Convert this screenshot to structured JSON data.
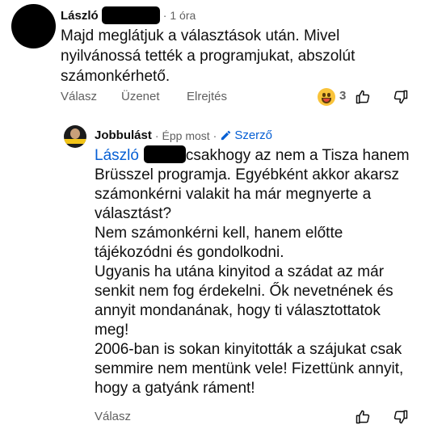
{
  "comment1": {
    "author": "László",
    "time": "1 óra",
    "text_lines": [
      "Majd meglátjuk a választások után. Mivel",
      "nyilvánossá tették a programjukat, abszolút",
      "számonkérhető."
    ],
    "actions": {
      "reply": "Válasz",
      "message": "Üzenet",
      "hide": "Elrejtés",
      "reaction_count": "3"
    }
  },
  "reply1": {
    "author": "Jobbulást",
    "time": "Épp most",
    "author_badge": "Szerző",
    "mention": "László",
    "first_line_rest": "csakhogy az nem a Tisza hanem",
    "text_lines": [
      "Brüsszel programja. Egyébként akkor akarsz",
      "számonkérni valakit ha már megnyerte a",
      "választást?",
      "Nem számonkérni kell, hanem előtte",
      "tájékozódni és gondolkodni.",
      "Ugyanis ha utána kinyitod a szádat az már",
      "senkit nem fog érdekelni. Ők nevetnének és",
      "annyit mondanának, hogy ti választottatok",
      "meg!",
      "2006-ban is sokan kinyitották a szájukat csak",
      "semmire nem mentünk vele! Fizettünk annyit,",
      "hogy a gatyánk ráment!"
    ],
    "actions": {
      "reply": "Válasz"
    }
  },
  "colors": {
    "link_blue": "#065fd4",
    "meta_gray": "#606060",
    "text": "#0f0f0f"
  },
  "icons": [
    "thumb-up-icon",
    "thumb-down-icon",
    "pencil-icon",
    "laughing-emoji-icon"
  ]
}
